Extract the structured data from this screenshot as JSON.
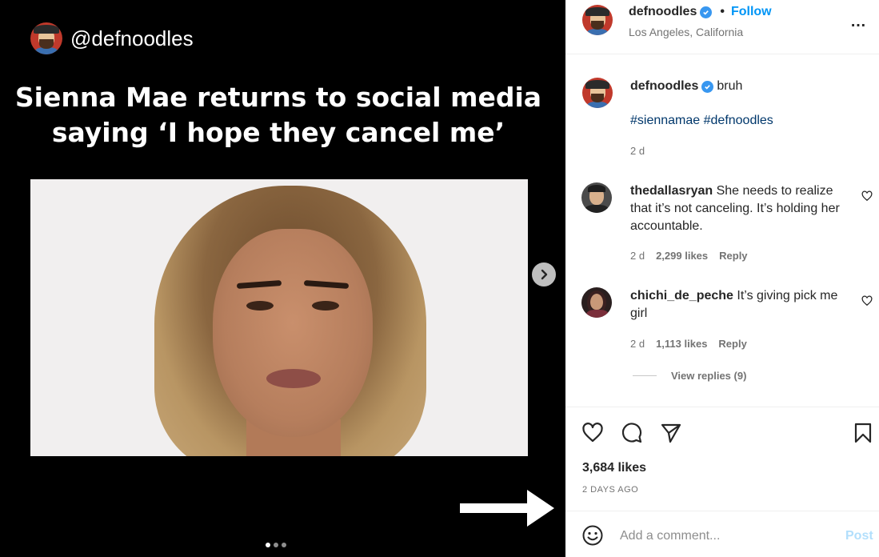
{
  "media": {
    "handle": "@defnoodles",
    "headline_line1": "Sienna Mae returns to social media",
    "headline_line2": "saying ‘I hope they cancel me’",
    "next_icon": "chevron-right-icon",
    "slide_count": 3,
    "active_slide": 1
  },
  "header": {
    "username": "defnoodles",
    "separator": "•",
    "follow_label": "Follow",
    "location": "Los Angeles, California",
    "more_label": "…"
  },
  "caption": {
    "username": "defnoodles",
    "text": "bruh",
    "hashtags": "#siennamae #defnoodles",
    "time": "2 d"
  },
  "comments": [
    {
      "username": "thedallasryan",
      "text": "She needs to realize that it’s not canceling. It’s holding her accountable.",
      "time": "2 d",
      "likes": "2,299 likes",
      "reply_label": "Reply"
    },
    {
      "username": "chichi_de_peche",
      "text": "It’s giving pick me girl",
      "time": "2 d",
      "likes": "1,113 likes",
      "reply_label": "Reply"
    }
  ],
  "view_replies": "View replies (9)",
  "actions": {
    "likes": "3,684 likes",
    "posted": "2 DAYS AGO"
  },
  "comment_box": {
    "placeholder": "Add a comment...",
    "post_label": "Post"
  },
  "colors": {
    "accent": "#0095f6",
    "verified": "#3897f0",
    "post_disabled": "#b2dffc"
  }
}
